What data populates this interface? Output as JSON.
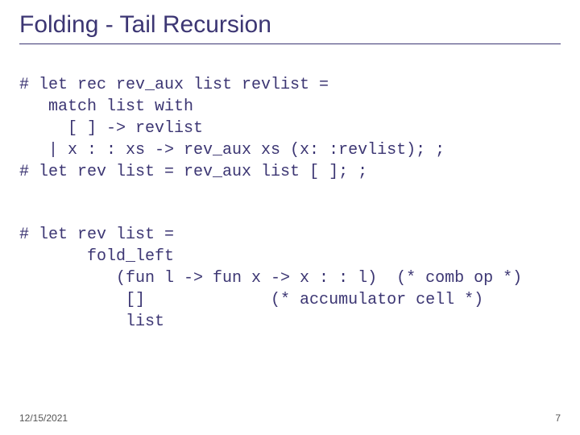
{
  "title": "Folding - Tail Recursion",
  "code1": "# let rec rev_aux list revlist =\n   match list with\n     [ ] -> revlist\n   | x : : xs -> rev_aux xs (x: :revlist); ;\n# let rev list = rev_aux list [ ]; ;",
  "code2": "# let rev list =\n       fold_left\n          (fun l -> fun x -> x : : l)  (* comb op *)\n           []             (* accumulator cell *)\n           list",
  "footer": {
    "date": "12/15/2021",
    "page": "7"
  }
}
